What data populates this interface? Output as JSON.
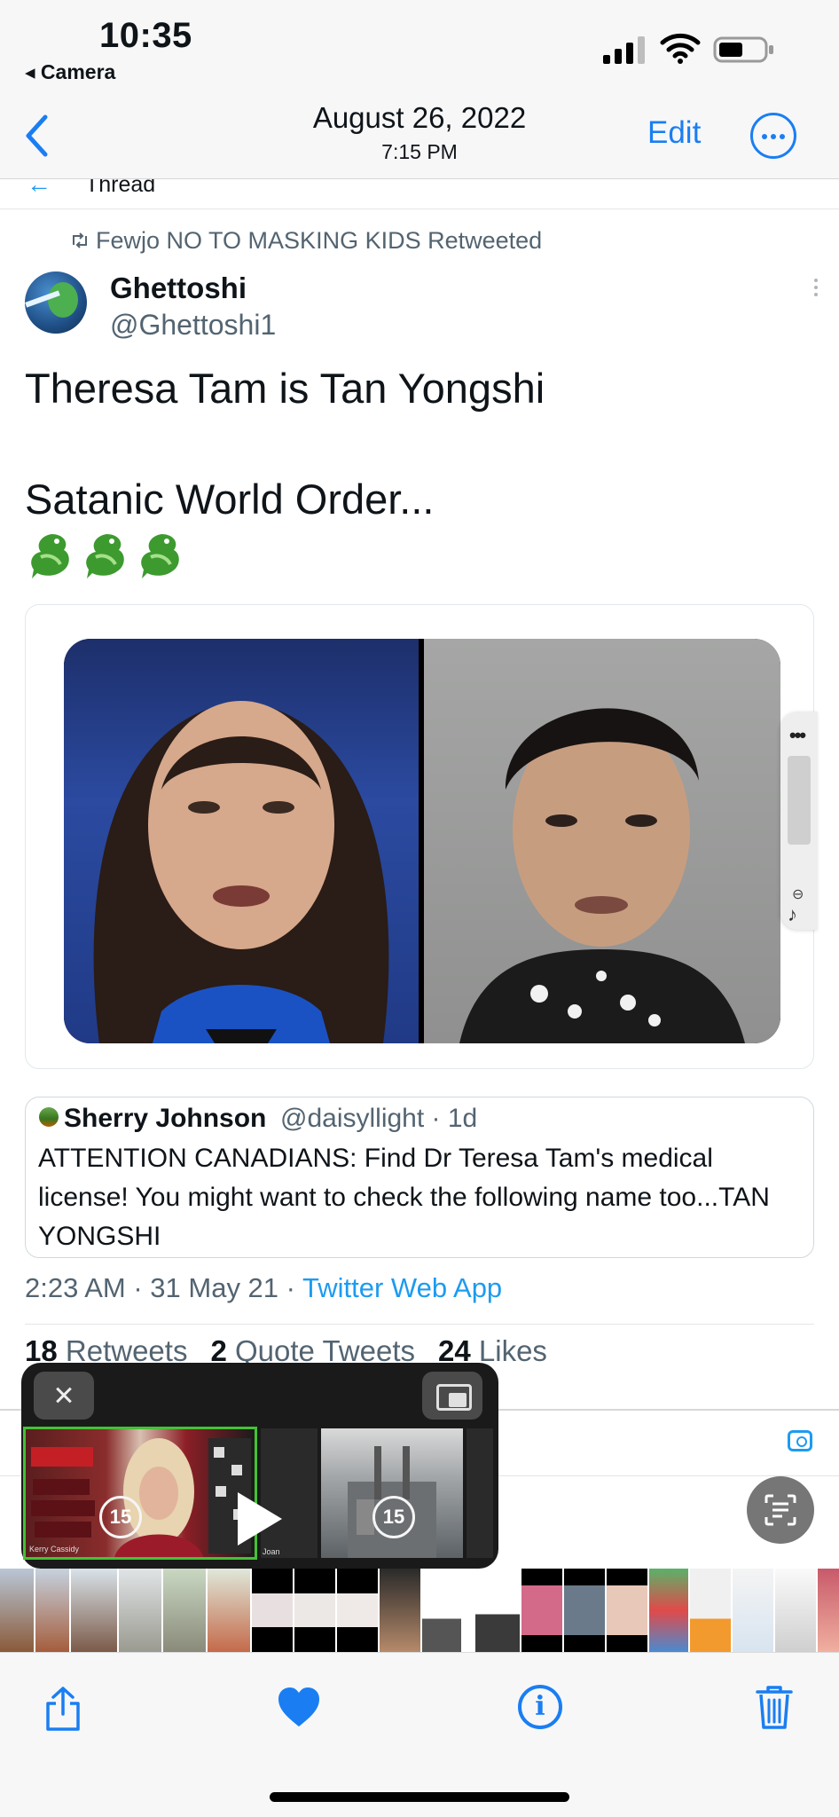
{
  "status_bar": {
    "time": "10:35",
    "back_app": "◂ Camera"
  },
  "header": {
    "date": "August 26, 2022",
    "time": "7:15 PM",
    "edit_label": "Edit"
  },
  "tweet": {
    "thread_label": "Thread",
    "retweeted_by": "Fewjo NO TO MASKING KIDS Retweeted",
    "display_name": "Ghettoshi",
    "handle": "@Ghettoshi1",
    "text_line1": "Theresa Tam is Tan Yongshi",
    "text_line2": "Satanic World Order...",
    "quoted": {
      "name": "Sherry Johnson",
      "meta": "@daisyllight · 1d",
      "text": "ATTENTION CANADIANS: Find Dr Teresa Tam's medical license! You might want to check the following name too...TAN YONGSHI"
    },
    "timestamp": "2:23 AM · 31 May 21 · ",
    "source": "Twitter Web App",
    "stats": {
      "retweets_count": "18",
      "retweets_label": "Retweets",
      "quotes_count": "2",
      "quotes_label": "Quote Tweets",
      "likes_count": "24",
      "likes_label": "Likes"
    }
  },
  "pip": {
    "skip_back": "15",
    "skip_forward": "15",
    "thumb_caption1": "Kerry Cassidy",
    "thumb_caption2": "Joan"
  },
  "colors": {
    "ios_blue": "#1a7ef2",
    "twitter_blue": "#1d9bf0",
    "secondary_text": "#536471",
    "pip_highlight": "#43c235"
  },
  "icons": {
    "back": "chevron-left-icon",
    "more": "ellipsis-circle-icon",
    "share": "share-icon",
    "favorite": "heart-icon",
    "info": "info-icon",
    "delete": "trash-icon"
  }
}
